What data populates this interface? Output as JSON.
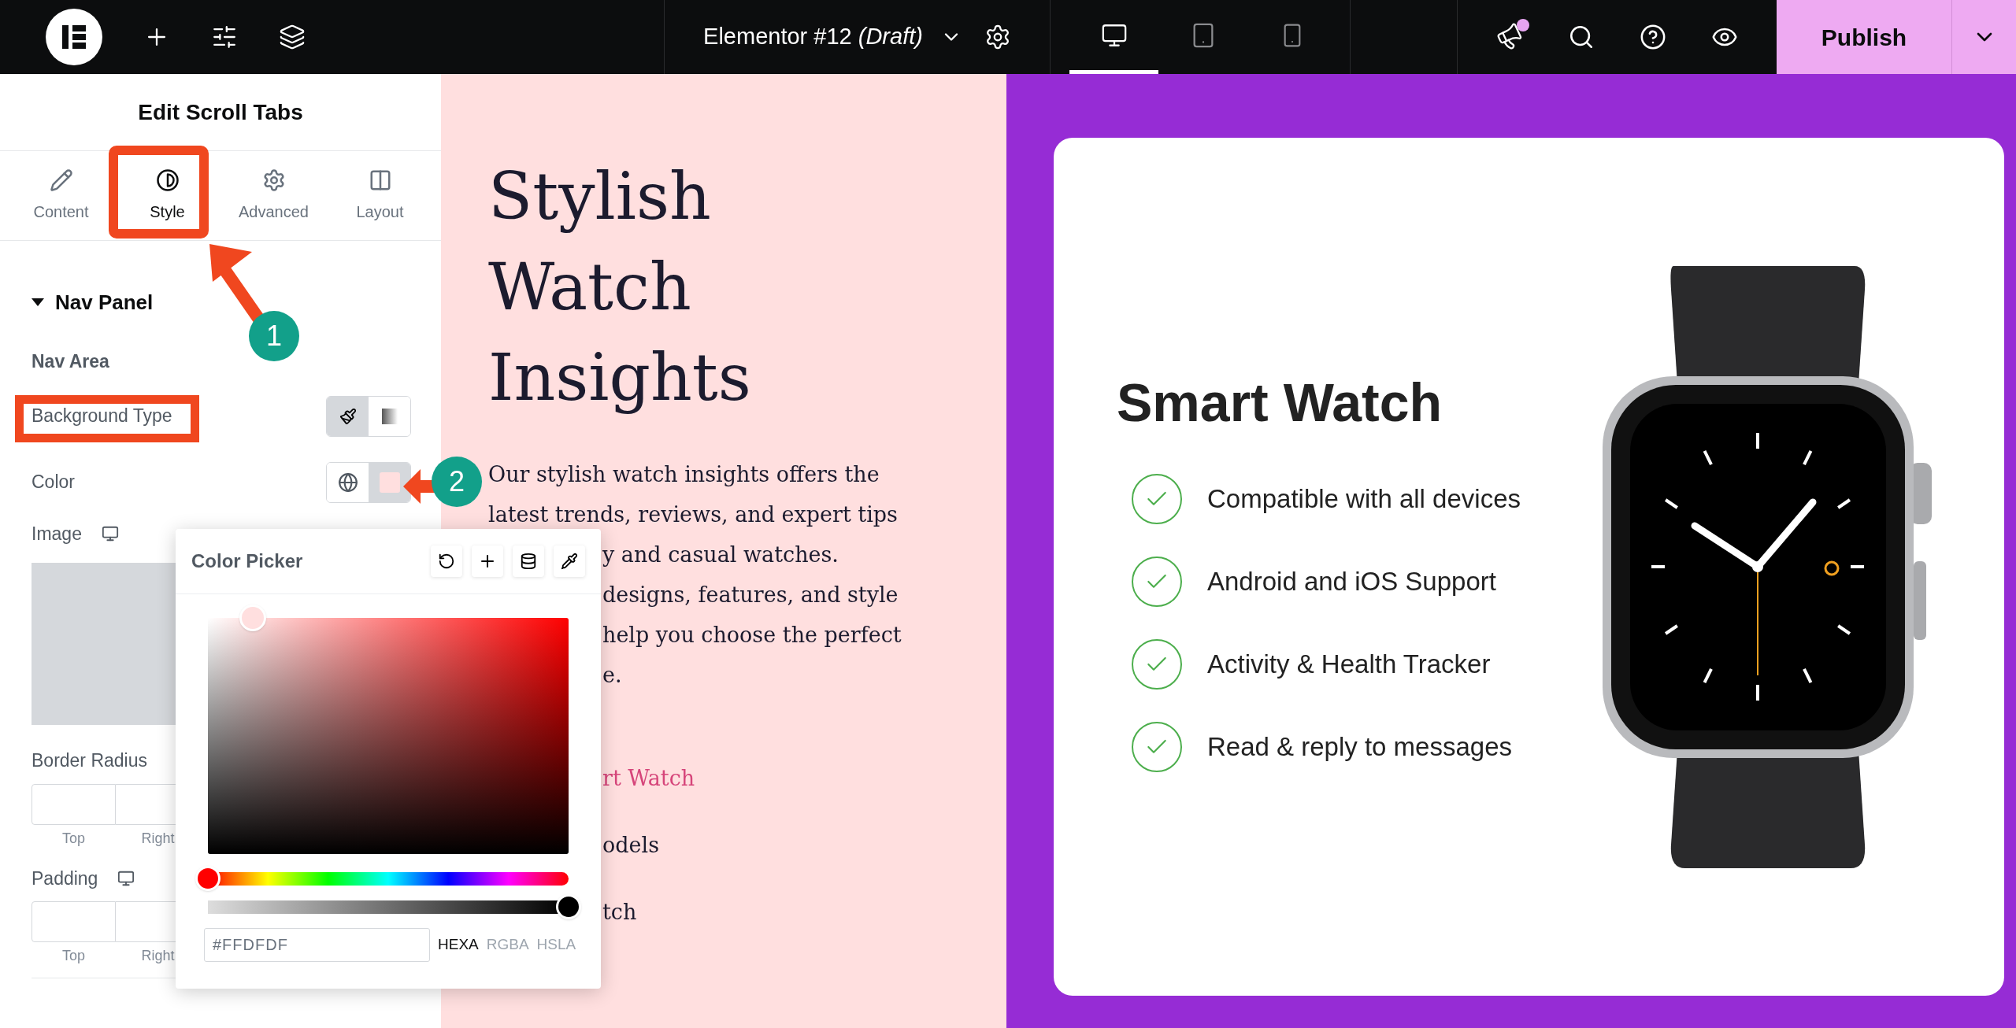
{
  "toolbar": {
    "document_title": "Elementor #12",
    "document_status": "(Draft)",
    "devices": [
      {
        "kind": "desktop",
        "selected": true
      },
      {
        "kind": "tablet",
        "selected": false
      },
      {
        "kind": "mobile",
        "selected": false
      }
    ],
    "has_notification": true,
    "publish_label": "Publish"
  },
  "panel": {
    "title": "Edit Scroll Tabs",
    "tabs": [
      {
        "kind": "content",
        "label": "Content",
        "selected": false
      },
      {
        "kind": "style",
        "label": "Style",
        "selected": true
      },
      {
        "kind": "advanced",
        "label": "Advanced",
        "selected": false
      },
      {
        "kind": "layout",
        "label": "Layout",
        "selected": false
      }
    ],
    "section": {
      "title": "Nav Panel",
      "expanded": true
    },
    "subsection": "Nav Area",
    "background_type": {
      "label": "Background Type",
      "options": [
        {
          "kind": "classic",
          "selected": true
        },
        {
          "kind": "gradient",
          "selected": false
        }
      ]
    },
    "color": {
      "label": "Color"
    },
    "image": {
      "label": "Image"
    },
    "border_radius": {
      "label": "Border Radius",
      "fields": [
        "Top",
        "Right"
      ]
    },
    "padding": {
      "label": "Padding",
      "fields": [
        "Top",
        "Right"
      ]
    }
  },
  "color_picker": {
    "title": "Color Picker",
    "value": "#FFDFDF",
    "hue": {
      "level": 0
    },
    "alpha": {
      "level": 1
    },
    "formats": [
      {
        "label": "HEXA",
        "selected": true
      },
      {
        "label": "RGBA",
        "selected": false
      },
      {
        "label": "HSLA",
        "selected": false
      }
    ]
  },
  "annotations": [
    {
      "label": "1"
    },
    {
      "label": "2"
    }
  ],
  "hero": {
    "heading_lines": [
      "Stylish",
      "Watch",
      "Insights"
    ],
    "paragraph_lines": [
      "Our stylish watch insights offers the",
      "latest trends, reviews, and expert tips"
    ],
    "covered_lines": [
      "y and casual watches.",
      "designs, features, and style",
      "help you choose the perfect",
      "e."
    ],
    "links": [
      {
        "label": "rt Watch",
        "selected": true
      },
      {
        "label": "odels",
        "selected": false
      },
      {
        "label": "tch",
        "selected": false
      }
    ]
  },
  "card": {
    "title": "Smart Watch",
    "features": [
      "Compatible with all devices",
      "Android and iOS Support",
      "Activity & Health Tracker",
      "Read & reply to messages"
    ]
  }
}
